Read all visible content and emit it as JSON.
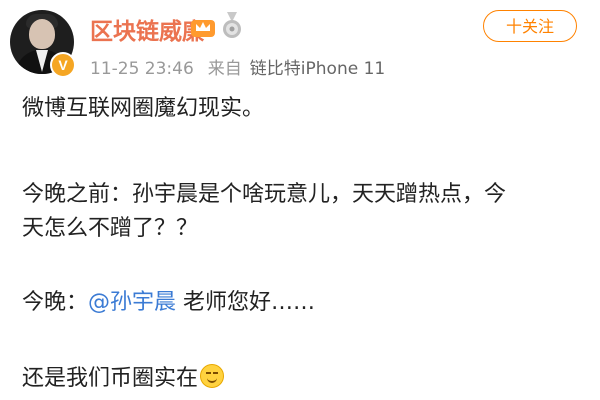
{
  "header": {
    "username": "区块链威廉",
    "verified_badge": "V",
    "time": "11-25 23:46",
    "from_label": "来自",
    "source": "链比特iPhone 11",
    "follow_label": "十关注"
  },
  "post": {
    "line1": "微博互联网圈魔幻现实。",
    "line2": "今晚之前：孙宇晨是个啥玩意儿，天天蹭热点，今",
    "line3": "天怎么不蹭了？？",
    "line4_prefix": "今晚：",
    "line4_mention": "@孙宇晨",
    "line4_suffix": " 老师您好……",
    "line5": "还是我们币圈实在"
  },
  "icons": {
    "crown": "crown-membership-icon",
    "medal": "medal-icon",
    "emoji": "smile-emoji-icon",
    "verified": "verified-v-icon"
  },
  "colors": {
    "username": "#eb7350",
    "follow": "#ff8200",
    "mention": "#3b7bd4",
    "meta": "#999999"
  }
}
